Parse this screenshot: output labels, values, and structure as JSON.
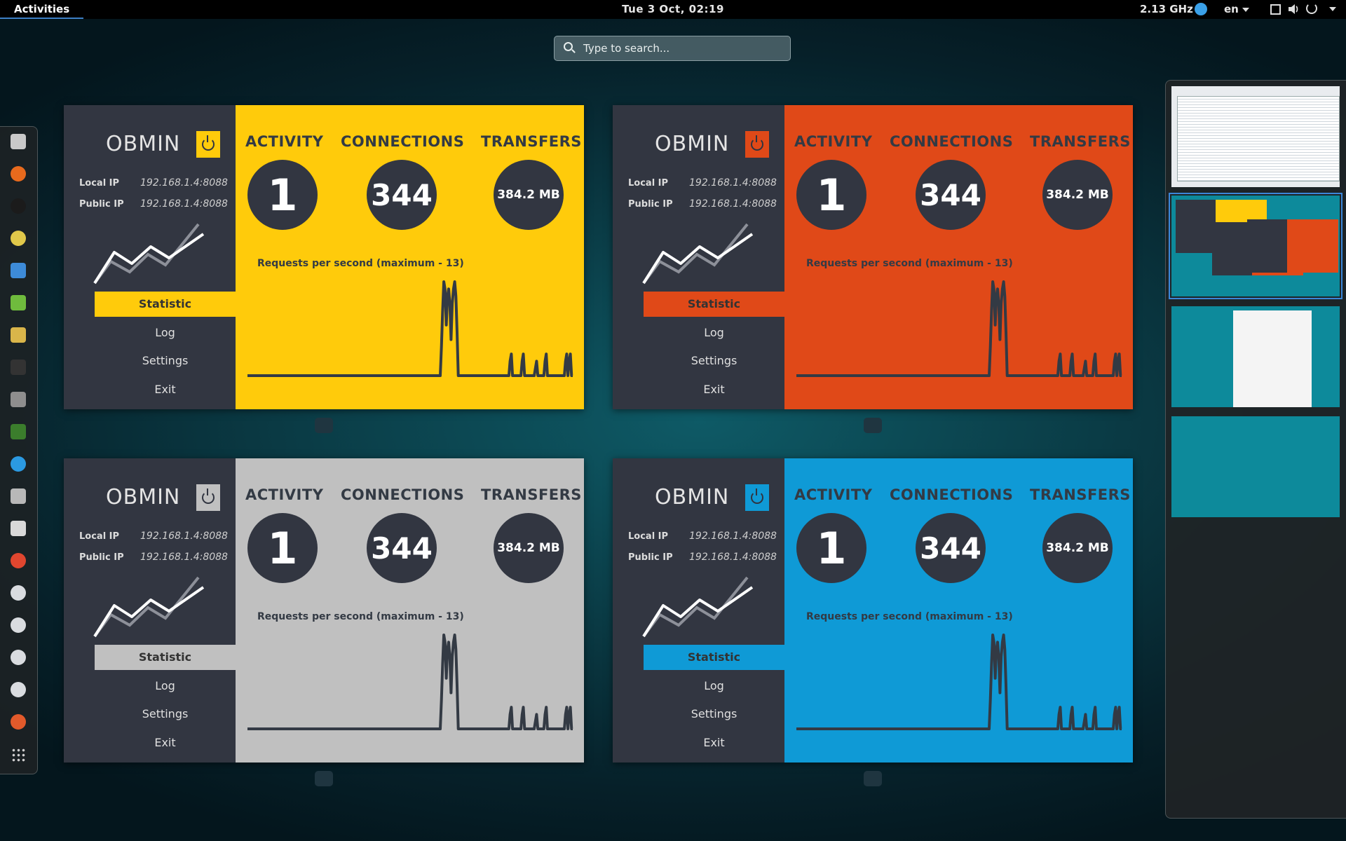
{
  "topbar": {
    "activities": "Activities",
    "clock": "Tue  3 Oct, 02:19",
    "cpu": "2.13 GHz",
    "language": "en"
  },
  "search": {
    "placeholder": "Type to search..."
  },
  "dash": {
    "apps": [
      {
        "icon": "file-manager-icon",
        "color": "#c9c9c9"
      },
      {
        "icon": "firefox-icon",
        "color": "#e86a1d"
      },
      {
        "icon": "amazon-icon",
        "color": "#1b1b1b"
      },
      {
        "icon": "skype-icon",
        "color": "#e0c84a"
      },
      {
        "icon": "document-viewer-icon",
        "color": "#3d8bd8"
      },
      {
        "icon": "chat-icon",
        "color": "#6fbb3d"
      },
      {
        "icon": "text-editor-icon",
        "color": "#d9b54a"
      },
      {
        "icon": "terminal-icon",
        "color": "#333333"
      },
      {
        "icon": "gimp-icon",
        "color": "#8e8e8e"
      },
      {
        "icon": "system-monitor-icon",
        "color": "#3b7d2c"
      },
      {
        "icon": "messenger-icon",
        "color": "#2b9ae2"
      },
      {
        "icon": "scanner-icon",
        "color": "#b8b8b8"
      },
      {
        "icon": "calculator-icon",
        "color": "#d9d9d9"
      },
      {
        "icon": "photos-icon",
        "color": "#e0462f"
      },
      {
        "icon": "eclipse-icon-1",
        "color": "#d9dce0"
      },
      {
        "icon": "eclipse-icon-2",
        "color": "#d9dce0"
      },
      {
        "icon": "eclipse-icon-3",
        "color": "#d9dce0"
      },
      {
        "icon": "eclipse-icon-4",
        "color": "#d9dce0"
      },
      {
        "icon": "firefox-dev-icon",
        "color": "#e25a2b"
      },
      {
        "icon": "show-apps-icon",
        "color": "#cfcfcf"
      }
    ]
  },
  "windows": [
    {
      "accent": "#ffcb0b",
      "title": "OBMIN",
      "local_ip_label": "Local IP",
      "local_ip": "192.168.1.4:8088",
      "public_ip_label": "Public IP",
      "public_ip": "192.168.1.4:8088",
      "menu": [
        "Statistic",
        "Log",
        "Settings",
        "Exit"
      ],
      "activity_label": "ACTIVITY",
      "activity": "1",
      "connections_label": "CONNECTIONS",
      "connections": "344",
      "transfers_label": "TRANSFERS",
      "transfers": "384.2 MB",
      "chart_title": "Requests per second (maximum - 13)"
    },
    {
      "accent": "#e04918",
      "title": "OBMIN",
      "local_ip_label": "Local IP",
      "local_ip": "192.168.1.4:8088",
      "public_ip_label": "Public IP",
      "public_ip": "192.168.1.4:8088",
      "menu": [
        "Statistic",
        "Log",
        "Settings",
        "Exit"
      ],
      "activity_label": "ACTIVITY",
      "activity": "1",
      "connections_label": "CONNECTIONS",
      "connections": "344",
      "transfers_label": "TRANSFERS",
      "transfers": "384.2 MB",
      "chart_title": "Requests per second (maximum - 13)"
    },
    {
      "accent": "#c0c0c0",
      "title": "OBMIN",
      "local_ip_label": "Local IP",
      "local_ip": "192.168.1.4:8088",
      "public_ip_label": "Public IP",
      "public_ip": "192.168.1.4:8088",
      "menu": [
        "Statistic",
        "Log",
        "Settings",
        "Exit"
      ],
      "activity_label": "ACTIVITY",
      "activity": "1",
      "connections_label": "CONNECTIONS",
      "connections": "344",
      "transfers_label": "TRANSFERS",
      "transfers": "384.2 MB",
      "chart_title": "Requests per second (maximum - 13)"
    },
    {
      "accent": "#0f9ad6",
      "title": "OBMIN",
      "local_ip_label": "Local IP",
      "local_ip": "192.168.1.4:8088",
      "public_ip_label": "Public IP",
      "public_ip": "192.168.1.4:8088",
      "menu": [
        "Statistic",
        "Log",
        "Settings",
        "Exit"
      ],
      "activity_label": "ACTIVITY",
      "activity": "1",
      "connections_label": "CONNECTIONS",
      "connections": "344",
      "transfers_label": "TRANSFERS",
      "transfers": "384.2 MB",
      "chart_title": "Requests per second (maximum - 13)"
    }
  ],
  "requests_per_second": [
    0,
    0,
    0,
    0,
    0,
    0,
    0,
    0,
    0,
    0,
    0,
    0,
    0,
    0,
    0,
    0,
    0,
    0,
    0,
    0,
    0,
    0,
    0,
    0,
    0,
    0,
    0,
    0,
    0,
    0,
    0,
    0,
    0,
    0,
    0,
    0,
    0,
    0,
    0,
    0,
    0,
    0,
    0,
    0,
    0,
    0,
    0,
    0,
    0,
    0,
    0,
    0,
    0,
    0,
    0,
    0,
    0,
    0,
    0,
    0,
    0,
    0,
    0,
    0,
    0,
    0,
    0,
    0,
    0,
    0,
    0,
    0,
    0,
    0,
    0,
    0,
    0,
    0,
    0,
    0,
    0,
    0,
    0,
    0,
    0,
    0,
    0,
    0,
    0,
    0,
    0,
    0,
    0,
    0,
    0,
    0,
    0,
    0,
    0,
    0,
    0,
    0,
    0,
    0,
    0,
    0,
    0,
    0,
    0,
    0,
    0,
    0,
    0,
    0,
    0,
    0,
    0,
    0,
    0,
    0,
    0,
    0,
    0,
    0,
    0,
    0,
    0,
    0,
    0,
    0,
    0,
    0,
    0,
    0,
    0,
    0,
    0,
    0,
    0,
    0,
    0,
    0,
    0,
    0,
    0,
    0,
    0,
    0,
    0,
    0,
    0,
    0,
    0,
    0,
    0,
    0,
    0,
    0,
    0,
    0,
    0,
    4,
    9,
    13,
    12,
    7,
    11,
    12,
    10,
    5,
    10,
    12,
    13,
    11,
    6,
    0,
    0,
    0,
    0,
    0,
    0,
    0,
    0,
    0,
    0,
    0,
    0,
    0,
    0,
    0,
    0,
    0,
    0,
    0,
    0,
    0,
    0,
    0,
    0,
    0,
    0,
    0,
    0,
    0,
    0,
    0,
    0,
    0,
    0,
    0,
    0,
    0,
    0,
    0,
    0,
    0,
    0,
    0,
    2,
    3,
    0,
    0,
    0,
    0,
    0,
    0,
    0,
    0,
    2,
    3,
    0,
    0,
    0,
    0,
    0,
    0,
    0,
    0,
    0,
    1,
    2,
    0,
    0,
    0,
    0,
    0,
    0,
    2,
    3,
    0,
    0,
    0,
    0,
    0,
    0,
    0,
    0,
    0,
    0,
    0,
    0,
    0,
    0,
    0,
    2,
    3,
    0,
    2,
    3,
    0,
    0
  ],
  "workspaces": [
    {
      "preview": "editor"
    },
    {
      "preview": "obmin"
    },
    {
      "preview": "browser"
    },
    {
      "preview": "empty"
    }
  ]
}
